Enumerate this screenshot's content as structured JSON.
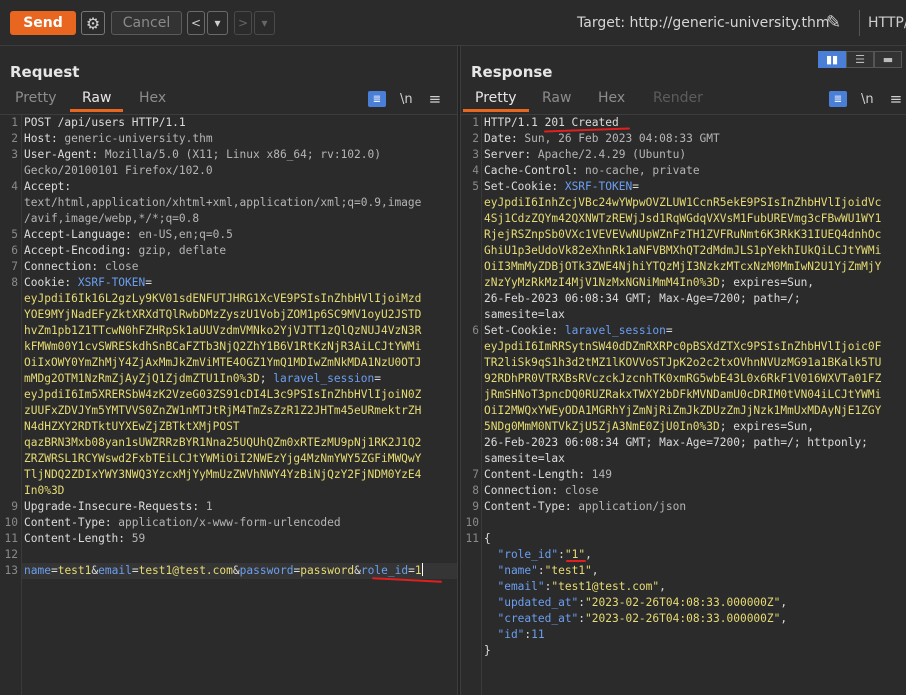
{
  "toolbar": {
    "send_label": "Send",
    "cancel_label": "Cancel",
    "back_label": "<",
    "back_menu": "▾",
    "forward_label": ">",
    "forward_menu": "▾",
    "target_label": "Target: http://generic-university.thm",
    "protocol_label": "HTTP/",
    "icons": [
      "gear-icon",
      "pencil-icon"
    ]
  },
  "layout_buttons": [
    "split-horizontal",
    "split-vertical",
    "single"
  ],
  "request": {
    "title": "Request",
    "tabs": [
      "Pretty",
      "Raw",
      "Hex"
    ],
    "active_tab": "Raw",
    "newline_label": "\\n",
    "menu_label": "≡",
    "lines": [
      {
        "n": "1",
        "parts": [
          {
            "t": "POST /api/users HTTP/1.1",
            "c": "k"
          }
        ]
      },
      {
        "n": "2",
        "parts": [
          {
            "t": "Host: ",
            "c": "k"
          },
          {
            "t": "generic-university.thm",
            "c": "v"
          }
        ]
      },
      {
        "n": "3",
        "parts": [
          {
            "t": "User-Agent: ",
            "c": "k"
          },
          {
            "t": "Mozilla/5.0 (X11; Linux x86_64; rv:102.0)",
            "c": "v"
          }
        ]
      },
      {
        "n": "",
        "parts": [
          {
            "t": "Gecko/20100101 Firefox/102.0",
            "c": "v"
          }
        ]
      },
      {
        "n": "4",
        "parts": [
          {
            "t": "Accept:",
            "c": "k"
          }
        ]
      },
      {
        "n": "",
        "parts": [
          {
            "t": "text/html,application/xhtml+xml,application/xml;q=0.9,image",
            "c": "v"
          }
        ]
      },
      {
        "n": "",
        "parts": [
          {
            "t": "/avif,image/webp,*/*;q=0.8",
            "c": "v"
          }
        ]
      },
      {
        "n": "5",
        "parts": [
          {
            "t": "Accept-Language: ",
            "c": "k"
          },
          {
            "t": "en-US,en;q=0.5",
            "c": "v"
          }
        ]
      },
      {
        "n": "6",
        "parts": [
          {
            "t": "Accept-Encoding: ",
            "c": "k"
          },
          {
            "t": "gzip, deflate",
            "c": "v"
          }
        ]
      },
      {
        "n": "7",
        "parts": [
          {
            "t": "Connection: ",
            "c": "k"
          },
          {
            "t": "close",
            "c": "v"
          }
        ]
      },
      {
        "n": "8",
        "parts": [
          {
            "t": "Cookie: ",
            "c": "k"
          },
          {
            "t": "XSRF-TOKEN",
            "c": "b"
          },
          {
            "t": "=",
            "c": "k"
          }
        ]
      },
      {
        "n": "",
        "parts": [
          {
            "t": "eyJpdiI6Ik16L2gzLy9KV01sdENFUTJHRG1XcVE9PSIsInZhbHVlIjoiMzd",
            "c": "c"
          }
        ]
      },
      {
        "n": "",
        "parts": [
          {
            "t": "YOE9MYjNadEFyZktXRXdTQlRwbDMzZyszU1VobjZOM1p6SC9MV1oyU2JSTD",
            "c": "c"
          }
        ]
      },
      {
        "n": "",
        "parts": [
          {
            "t": "hvZm1pb1Z1TTcwN0hFZHRpSk1aUUVzdmVMNko2YjVJTT1zQlQzNUJ4VzN3R",
            "c": "c"
          }
        ]
      },
      {
        "n": "",
        "parts": [
          {
            "t": "kFMWm00Y1cvSWRESkdhSnBCaFZTb3NjQ2ZhY1B6V1RtKzNjR3AiLCJtYWMi",
            "c": "c"
          }
        ]
      },
      {
        "n": "",
        "parts": [
          {
            "t": "OiIxOWY0YmZhMjY4ZjAxMmJkZmViMTE4OGZ1YmQ1MDIwZmNkMDA1NzU0OTJ",
            "c": "c"
          }
        ]
      },
      {
        "n": "",
        "parts": [
          {
            "t": "mMDg2OTM1NzRmZjAyZjQ1ZjdmZTU1In0%3D",
            "c": "c"
          },
          {
            "t": "; ",
            "c": "k"
          },
          {
            "t": "laravel_session",
            "c": "b"
          },
          {
            "t": "=",
            "c": "k"
          }
        ]
      },
      {
        "n": "",
        "parts": [
          {
            "t": "eyJpdiI6Im5XRERSbW4zK2VzeG03ZS91cDI4L3c9PSIsInZhbHVlIjoiN0Z",
            "c": "c"
          }
        ]
      },
      {
        "n": "",
        "parts": [
          {
            "t": "zUUFxZDVJYm5YMTVVS0ZnZW1nMTJtRjM4TmZsZzR1Z2JHTm45eURmektrZH",
            "c": "c"
          }
        ]
      },
      {
        "n": "",
        "parts": [
          {
            "t": "N4dHZXY2RDTktUYXEwZjZBTktXMjPOST",
            "c": "c"
          }
        ]
      },
      {
        "n": "",
        "parts": [
          {
            "t": "qazBRN3Mxb08yan1sUWZRRzBYR1Nna25UQUhQZm0xRTEzMU9pNj1RK2J1Q2",
            "c": "c"
          }
        ]
      },
      {
        "n": "",
        "parts": [
          {
            "t": "ZRZWRSL1RCYWswd2FxbTEiLCJtYWMiOiI2NWEzYjg4MzNmYWY5ZGFiMWQwY",
            "c": "c"
          }
        ]
      },
      {
        "n": "",
        "parts": [
          {
            "t": "TljNDQ2ZDIxYWY3NWQ3YzcxMjYyMmUzZWVhNWY4YzBiNjQzY2FjNDM0YzE4",
            "c": "c"
          }
        ]
      },
      {
        "n": "",
        "parts": [
          {
            "t": "In0%3D",
            "c": "c"
          }
        ]
      },
      {
        "n": "9",
        "parts": [
          {
            "t": "Upgrade-Insecure-Requests: ",
            "c": "k"
          },
          {
            "t": "1",
            "c": "v"
          }
        ]
      },
      {
        "n": "10",
        "parts": [
          {
            "t": "Content-Type: ",
            "c": "k"
          },
          {
            "t": "application/x-www-form-urlencoded",
            "c": "v"
          }
        ]
      },
      {
        "n": "11",
        "parts": [
          {
            "t": "Content-Length: ",
            "c": "k"
          },
          {
            "t": "59",
            "c": "v"
          }
        ]
      },
      {
        "n": "12",
        "parts": []
      },
      {
        "n": "13",
        "parts": [
          {
            "t": "name",
            "c": "b"
          },
          {
            "t": "=",
            "c": "k"
          },
          {
            "t": "test1",
            "c": "c"
          },
          {
            "t": "&",
            "c": "k"
          },
          {
            "t": "email",
            "c": "b"
          },
          {
            "t": "=",
            "c": "k"
          },
          {
            "t": "test1@test.com",
            "c": "c"
          },
          {
            "t": "&",
            "c": "k"
          },
          {
            "t": "password",
            "c": "b"
          },
          {
            "t": "=",
            "c": "k"
          },
          {
            "t": "password",
            "c": "c"
          },
          {
            "t": "&",
            "c": "k"
          },
          {
            "t": "role_id",
            "c": "b"
          },
          {
            "t": "=",
            "c": "k"
          },
          {
            "t": "1",
            "c": "c"
          }
        ]
      }
    ]
  },
  "response": {
    "title": "Response",
    "tabs": [
      "Pretty",
      "Raw",
      "Hex",
      "Render"
    ],
    "active_tab": "Pretty",
    "newline_label": "\\n",
    "menu_label": "≡",
    "lines": [
      {
        "n": "1",
        "parts": [
          {
            "t": "HTTP/1.1 201 Created",
            "c": "k"
          }
        ]
      },
      {
        "n": "2",
        "parts": [
          {
            "t": "Date: ",
            "c": "k"
          },
          {
            "t": "Sun, 26 Feb 2023 04:08:33 GMT",
            "c": "v"
          }
        ]
      },
      {
        "n": "3",
        "parts": [
          {
            "t": "Server: ",
            "c": "k"
          },
          {
            "t": "Apache/2.4.29 (Ubuntu)",
            "c": "v"
          }
        ]
      },
      {
        "n": "4",
        "parts": [
          {
            "t": "Cache-Control: ",
            "c": "k"
          },
          {
            "t": "no-cache, private",
            "c": "v"
          }
        ]
      },
      {
        "n": "5",
        "parts": [
          {
            "t": "Set-Cookie: ",
            "c": "k"
          },
          {
            "t": "XSRF-TOKEN",
            "c": "b"
          },
          {
            "t": "=",
            "c": "k"
          }
        ]
      },
      {
        "n": "",
        "parts": [
          {
            "t": "eyJpdiI6InhZcjVBc24wYWpwOVZLUW1CcnR5ekE9PSIsInZhbHVlIjoidVc",
            "c": "c"
          }
        ]
      },
      {
        "n": "",
        "parts": [
          {
            "t": "4Sj1CdzZQYm42QXNWTzREWjJsd1RqWGdqVXVsM1FubUREVmg3cFBwWU1WY1",
            "c": "c"
          }
        ]
      },
      {
        "n": "",
        "parts": [
          {
            "t": "RjejRSZnpSb0VXc1VEVEVwNUpWZnFzTH1ZVFRuNmt6K3RkK31IUEQ4dnhOc",
            "c": "c"
          }
        ]
      },
      {
        "n": "",
        "parts": [
          {
            "t": "GhiU1p3eUdoVk82eXhnRk1aNFVBMXhQT2dMdmJLS1pYekhIUkQiLCJtYWMi",
            "c": "c"
          }
        ]
      },
      {
        "n": "",
        "parts": [
          {
            "t": "OiI3MmMyZDBjOTk3ZWE4NjhiYTQzMjI3NzkzMTcxNzM0MmIwN2U1YjZmMjY",
            "c": "c"
          }
        ]
      },
      {
        "n": "",
        "parts": [
          {
            "t": "zNzYyMzRkMzI4MjV1NzMxNGNiMmM4In0%3D",
            "c": "c"
          },
          {
            "t": "; expires=Sun,",
            "c": "k"
          }
        ]
      },
      {
        "n": "",
        "parts": [
          {
            "t": "26-Feb-2023 06:08:34 GMT; Max-Age=7200; path=/;",
            "c": "k"
          }
        ]
      },
      {
        "n": "",
        "parts": [
          {
            "t": "samesite=lax",
            "c": "k"
          }
        ]
      },
      {
        "n": "6",
        "parts": [
          {
            "t": "Set-Cookie: ",
            "c": "k"
          },
          {
            "t": "laravel_session",
            "c": "b"
          },
          {
            "t": "=",
            "c": "k"
          }
        ]
      },
      {
        "n": "",
        "parts": [
          {
            "t": "eyJpdiI6ImRRSytnSW40dDZmRXRPc0pBSXdZTXc9PSIsInZhbHVlIjoic0F",
            "c": "c"
          }
        ]
      },
      {
        "n": "",
        "parts": [
          {
            "t": "TR2liSk9qS1h3d2tMZ1lKOVVoSTJpK2o2c2txOVhnNVUzMG91a1BKalk5TU",
            "c": "c"
          }
        ]
      },
      {
        "n": "",
        "parts": [
          {
            "t": "92RDhPR0VTRXBsRVczckJzcnhTK0xmRG5wbE43L0x6RkF1V016WXVTa01FZ",
            "c": "c"
          }
        ]
      },
      {
        "n": "",
        "parts": [
          {
            "t": "jRmSHNoT3pncDQ0RUZRakxTWXY2bDFkMVNDamU0cDRIM0tVN04iLCJtYWMi",
            "c": "c"
          }
        ]
      },
      {
        "n": "",
        "parts": [
          {
            "t": "OiI2MWQxYWEyODA1MGRhYjZmNjRiZmJkZDUzZmJjNzk1MmUxMDAyNjE1ZGY",
            "c": "c"
          }
        ]
      },
      {
        "n": "",
        "parts": [
          {
            "t": "5NDg0MmM0NTVkZjU5ZjA3NmE0ZjU0In0%3D",
            "c": "c"
          },
          {
            "t": "; expires=Sun,",
            "c": "k"
          }
        ]
      },
      {
        "n": "",
        "parts": [
          {
            "t": "26-Feb-2023 06:08:34 GMT; Max-Age=7200; path=/; httponly;",
            "c": "k"
          }
        ]
      },
      {
        "n": "",
        "parts": [
          {
            "t": "samesite=lax",
            "c": "k"
          }
        ]
      },
      {
        "n": "7",
        "parts": [
          {
            "t": "Content-Length: ",
            "c": "k"
          },
          {
            "t": "149",
            "c": "v"
          }
        ]
      },
      {
        "n": "8",
        "parts": [
          {
            "t": "Connection: ",
            "c": "k"
          },
          {
            "t": "close",
            "c": "v"
          }
        ]
      },
      {
        "n": "9",
        "parts": [
          {
            "t": "Content-Type: ",
            "c": "k"
          },
          {
            "t": "application/json",
            "c": "v"
          }
        ]
      },
      {
        "n": "10",
        "parts": []
      },
      {
        "n": "11",
        "parts": [
          {
            "t": "{",
            "c": "k"
          }
        ]
      },
      {
        "n": "",
        "parts": [
          {
            "t": "  \"role_id\"",
            "c": "b"
          },
          {
            "t": ":",
            "c": "k"
          },
          {
            "t": "\"1\"",
            "c": "c"
          },
          {
            "t": ",",
            "c": "k"
          }
        ]
      },
      {
        "n": "",
        "parts": [
          {
            "t": "  \"name\"",
            "c": "b"
          },
          {
            "t": ":",
            "c": "k"
          },
          {
            "t": "\"test1\"",
            "c": "c"
          },
          {
            "t": ",",
            "c": "k"
          }
        ]
      },
      {
        "n": "",
        "parts": [
          {
            "t": "  \"email\"",
            "c": "b"
          },
          {
            "t": ":",
            "c": "k"
          },
          {
            "t": "\"test1@test.com\"",
            "c": "c"
          },
          {
            "t": ",",
            "c": "k"
          }
        ]
      },
      {
        "n": "",
        "parts": [
          {
            "t": "  \"updated_at\"",
            "c": "b"
          },
          {
            "t": ":",
            "c": "k"
          },
          {
            "t": "\"2023-02-26T04:08:33.000000Z\"",
            "c": "c"
          },
          {
            "t": ",",
            "c": "k"
          }
        ]
      },
      {
        "n": "",
        "parts": [
          {
            "t": "  \"created_at\"",
            "c": "b"
          },
          {
            "t": ":",
            "c": "k"
          },
          {
            "t": "\"2023-02-26T04:08:33.000000Z\"",
            "c": "c"
          },
          {
            "t": ",",
            "c": "k"
          }
        ]
      },
      {
        "n": "",
        "parts": [
          {
            "t": "  \"id\"",
            "c": "b"
          },
          {
            "t": ":",
            "c": "k"
          },
          {
            "t": "11",
            "c": "b"
          }
        ]
      },
      {
        "n": "",
        "parts": [
          {
            "t": "}",
            "c": "k"
          }
        ]
      }
    ]
  },
  "colors": {
    "accent": "#e8661f",
    "selected": "#4a7fd8",
    "annotation": "#e02020"
  }
}
